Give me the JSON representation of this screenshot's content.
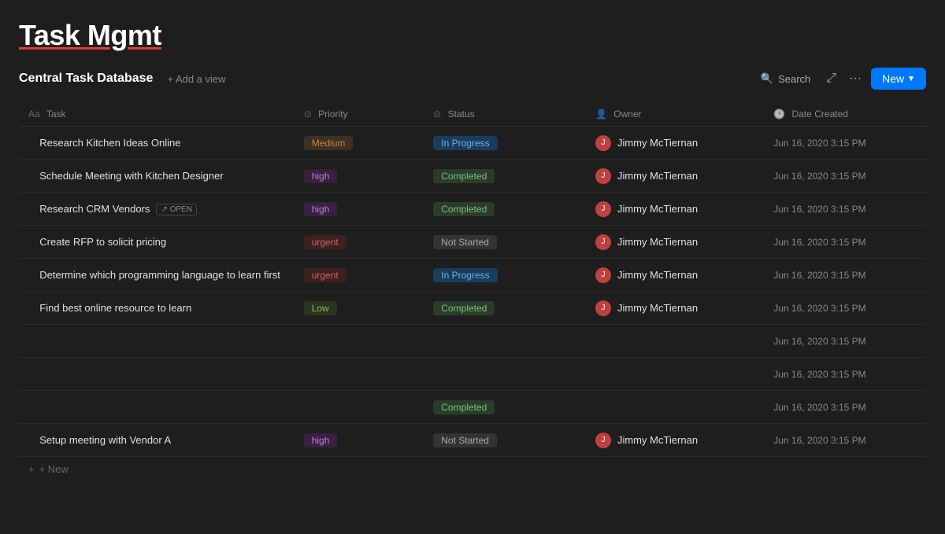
{
  "app": {
    "title_plain": "Task Mgmt",
    "title_underline": "Task Mgmt"
  },
  "toolbar": {
    "db_title": "Central Task Database",
    "add_view_label": "+ Add a view",
    "search_label": "Search",
    "new_label": "New",
    "more_icon": "···",
    "expand_icon": "⤢"
  },
  "columns": {
    "task_label": "Task",
    "priority_label": "Priority",
    "status_label": "Status",
    "owner_label": "Owner",
    "date_label": "Date Created"
  },
  "rows": [
    {
      "id": 1,
      "task": "Research Kitchen Ideas Online",
      "priority": "Medium",
      "priority_class": "priority-medium",
      "status": "In Progress",
      "status_class": "status-inprogress",
      "owner": "Jimmy McTiernan",
      "date": "Jun 16, 2020 3:15 PM",
      "open_badge": false
    },
    {
      "id": 2,
      "task": "Schedule Meeting with Kitchen Designer",
      "priority": "high",
      "priority_class": "priority-high",
      "status": "Completed",
      "status_class": "status-completed",
      "owner": "Jimmy McTiernan",
      "date": "Jun 16, 2020 3:15 PM",
      "open_badge": false
    },
    {
      "id": 3,
      "task": "Research CRM Vendors",
      "priority": "high",
      "priority_class": "priority-high",
      "status": "Completed",
      "status_class": "status-completed",
      "owner": "Jimmy McTiernan",
      "date": "Jun 16, 2020 3:15 PM",
      "open_badge": true
    },
    {
      "id": 4,
      "task": "Create RFP to solicit pricing",
      "priority": "urgent",
      "priority_class": "priority-urgent",
      "status": "Not Started",
      "status_class": "status-notstarted",
      "owner": "Jimmy McTiernan",
      "date": "Jun 16, 2020 3:15 PM",
      "open_badge": false
    },
    {
      "id": 5,
      "task": "Determine which programming language to learn first",
      "priority": "urgent",
      "priority_class": "priority-urgent",
      "status": "In Progress",
      "status_class": "status-inprogress",
      "owner": "Jimmy McTiernan",
      "date": "Jun 16, 2020 3:15 PM",
      "open_badge": false
    },
    {
      "id": 6,
      "task": "Find best online resource to learn",
      "priority": "Low",
      "priority_class": "priority-low",
      "status": "Completed",
      "status_class": "status-completed",
      "owner": "Jimmy McTiernan",
      "date": "Jun 16, 2020 3:15 PM",
      "open_badge": false
    },
    {
      "id": 7,
      "task": "",
      "priority": "",
      "priority_class": "",
      "status": "",
      "status_class": "",
      "owner": "",
      "date": "Jun 16, 2020 3:15 PM",
      "open_badge": false
    },
    {
      "id": 8,
      "task": "",
      "priority": "",
      "priority_class": "",
      "status": "",
      "status_class": "",
      "owner": "",
      "date": "Jun 16, 2020 3:15 PM",
      "open_badge": false
    },
    {
      "id": 9,
      "task": "",
      "priority": "",
      "priority_class": "",
      "status": "Completed",
      "status_class": "status-completed",
      "owner": "",
      "date": "Jun 16, 2020 3:15 PM",
      "open_badge": false
    },
    {
      "id": 10,
      "task": "Setup meeting with Vendor A",
      "priority": "high",
      "priority_class": "priority-high",
      "status": "Not Started",
      "status_class": "status-notstarted",
      "owner": "Jimmy McTiernan",
      "date": "Jun 16, 2020 3:15 PM",
      "open_badge": false
    }
  ],
  "add_new_label": "+ New"
}
